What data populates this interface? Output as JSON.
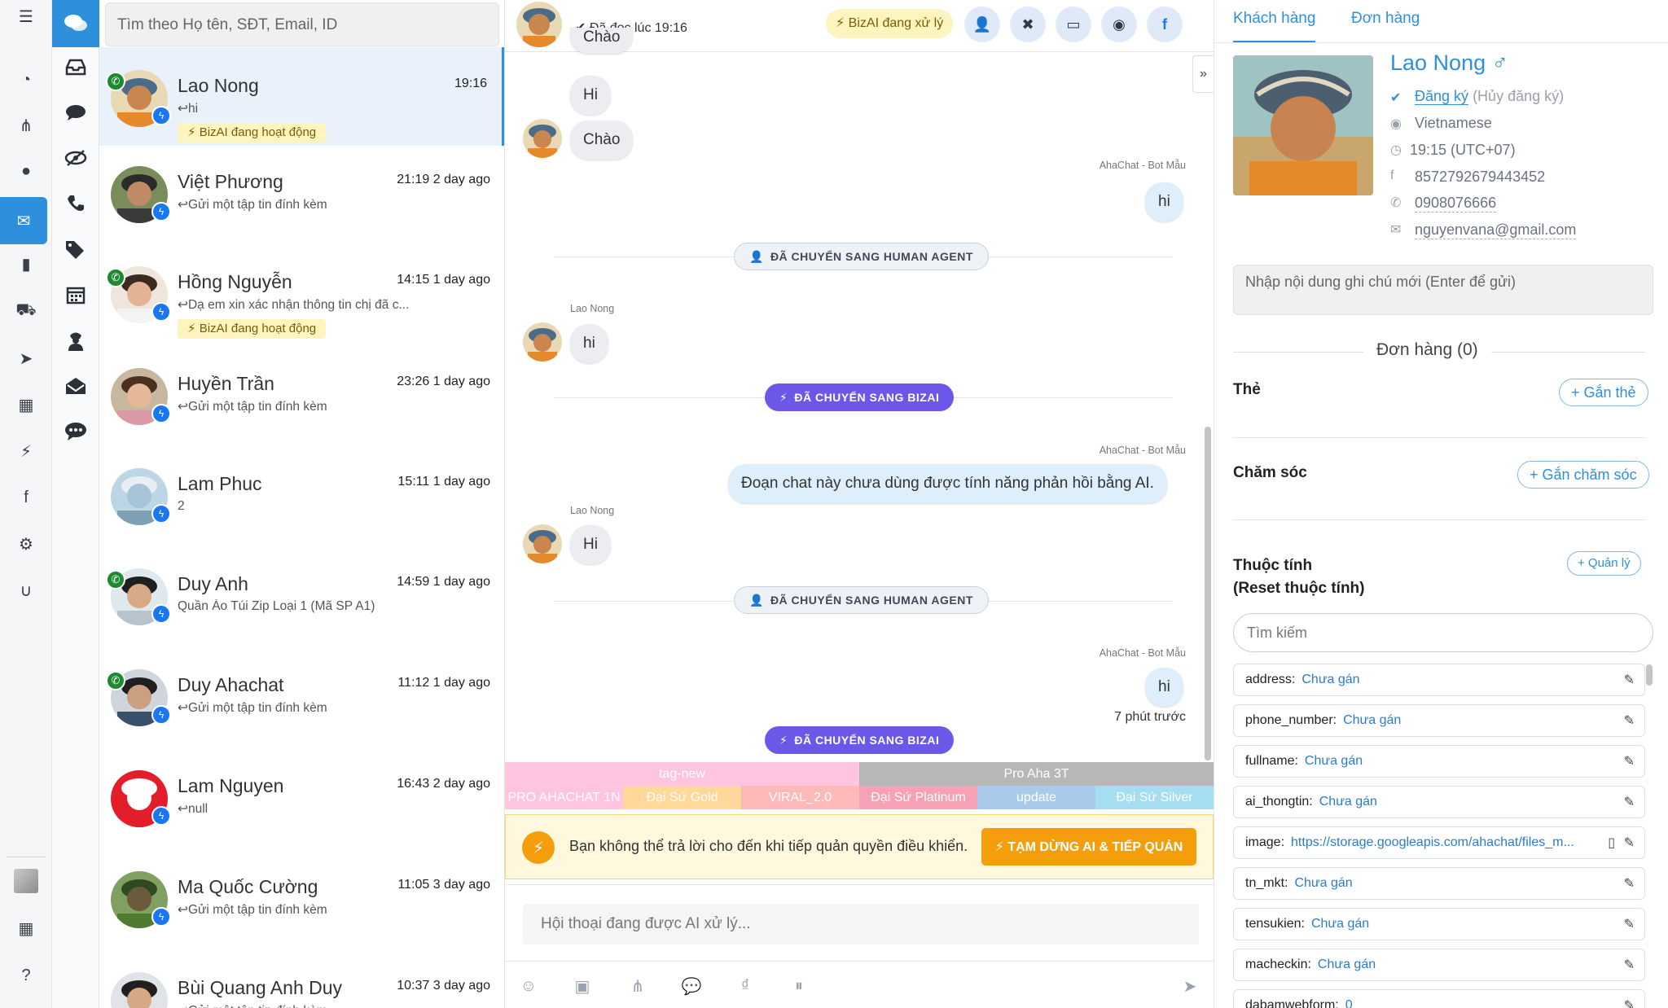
{
  "search": {
    "placeholder": "Tìm theo Họ tên, SĐT, Email, ID"
  },
  "conversations": [
    {
      "name": "Lao Nong",
      "time": "19:16",
      "preview": "↩hi",
      "badge": "BizAI đang hoạt động",
      "phone": true
    },
    {
      "name": "Việt Phương",
      "time": "21:19 2 day ago",
      "preview": "↩Gửi một tập tin đính kèm",
      "phone": false
    },
    {
      "name": "Hồng Nguyễn",
      "time": "14:15 1 day ago",
      "preview": "↩Dạ em xin xác nhận thông tin chị đã c...",
      "badge": "BizAI đang hoạt động",
      "phone": true
    },
    {
      "name": "Huyền Trần",
      "time": "23:26 1 day ago",
      "preview": "↩Gửi một tập tin đính kèm",
      "phone": false
    },
    {
      "name": "Lam Phuc",
      "time": "15:11 1 day ago",
      "preview": "2",
      "phone": false
    },
    {
      "name": "Duy Anh",
      "time": "14:59 1 day ago",
      "preview": "Quần Áo Túi Zip Loại 1 (Mã SP A1)",
      "phone": true
    },
    {
      "name": "Duy Ahachat",
      "time": "11:12 1 day ago",
      "preview": "↩Gửi một tập tin đính kèm",
      "phone": true
    },
    {
      "name": "Lam Nguyen",
      "time": "16:43 2 day ago",
      "preview": "↩null",
      "phone": false
    },
    {
      "name": "Ma Quốc Cường",
      "time": "11:05 3 day ago",
      "preview": "↩Gửi một tập tin đính kèm",
      "phone": false
    },
    {
      "name": "Bùi Quang Anh Duy",
      "time": "10:37 3 day ago",
      "preview": "↩Gửi một tập tin đính kèm",
      "phone": false
    }
  ],
  "chat_header": {
    "read_status": "✔ Đã đọc lúc 19:16",
    "bizai_status": "⚡ BizAI đang xử lý"
  },
  "messages": {
    "m1": "Chào",
    "m2": "Hi",
    "m3": "Chào",
    "bot_label": "AhaChat - Bot Mẫu",
    "user_label": "Lao Nong",
    "out1": "hi",
    "in_hi": "hi",
    "out2": "Đoạn chat này chưa dùng được tính năng phản hồi bằng AI.",
    "in_Hi": "Hi",
    "out3": "hi",
    "time_ago": "7 phút trước",
    "to_human": "ĐÃ CHUYỂN SANG HUMAN AGENT",
    "to_bizai": "ĐÃ CHUYỂN SANG BIZAI"
  },
  "tags": {
    "row1": [
      {
        "label": "tag-new",
        "color": "#ffc4e0"
      },
      {
        "label": "Pro Aha 3T",
        "color": "#b7b7b7"
      }
    ],
    "row2": [
      {
        "label": "PRO AHACHAT 1N",
        "color": "#ffc4e0"
      },
      {
        "label": "Đại Sứ Gold",
        "color": "#ffd89a"
      },
      {
        "label": "VIRAL_2.0",
        "color": "#ffb9b9"
      },
      {
        "label": "Đại Sứ Platinum",
        "color": "#f7a1b5"
      },
      {
        "label": "update",
        "color": "#a9cbe9"
      },
      {
        "label": "Đại Sứ Silver",
        "color": "#a4def0"
      }
    ]
  },
  "warning": {
    "text": "Bạn không thể trả lời cho đến khi tiếp quản quyền điều khiển.",
    "button": "⚡ TẠM DỪNG AI & TIẾP QUẢN"
  },
  "composer": {
    "placeholder": "Hội thoại đang được AI xử lý..."
  },
  "right": {
    "tab_customer": "Khách hàng",
    "tab_orders": "Đơn hàng",
    "name": "Lao Nong",
    "gender": "♂",
    "subscribed": "Đăng ký",
    "unsubscribe": "(Hủy đăng ký)",
    "language": "Vietnamese",
    "timezone": "19:15 (UTC+07)",
    "fb_id": "8572792679443452",
    "phone": "0908076666",
    "email": "nguyenvana@gmail.com",
    "note_placeholder": "Nhập nội dung ghi chú mới (Enter để gửi)",
    "orders_title": "Đơn hàng (0)",
    "tags_label": "Thẻ",
    "tags_btn": "+ Gắn thẻ",
    "care_label": "Chăm sóc",
    "care_btn": "+ Gắn chăm sóc",
    "attr_label": "Thuộc tính",
    "attr_reset": "(Reset thuộc tính)",
    "attr_manage": "+ Quản lý",
    "attr_search": "Tìm kiếm",
    "attributes": [
      {
        "key": "address:",
        "value": "Chưa gán"
      },
      {
        "key": "phone_number:",
        "value": "Chưa gán"
      },
      {
        "key": "fullname:",
        "value": "Chưa gán"
      },
      {
        "key": "ai_thongtin:",
        "value": "Chưa gán"
      },
      {
        "key": "image:",
        "value": "https://storage.googleapis.com/ahachat/files_m..."
      },
      {
        "key": "tn_mkt:",
        "value": "Chưa gán"
      },
      {
        "key": "tensukien:",
        "value": "Chưa gán"
      },
      {
        "key": "macheckin:",
        "value": "Chưa gán"
      },
      {
        "key": "dabamwebform:",
        "value": "0"
      }
    ]
  }
}
